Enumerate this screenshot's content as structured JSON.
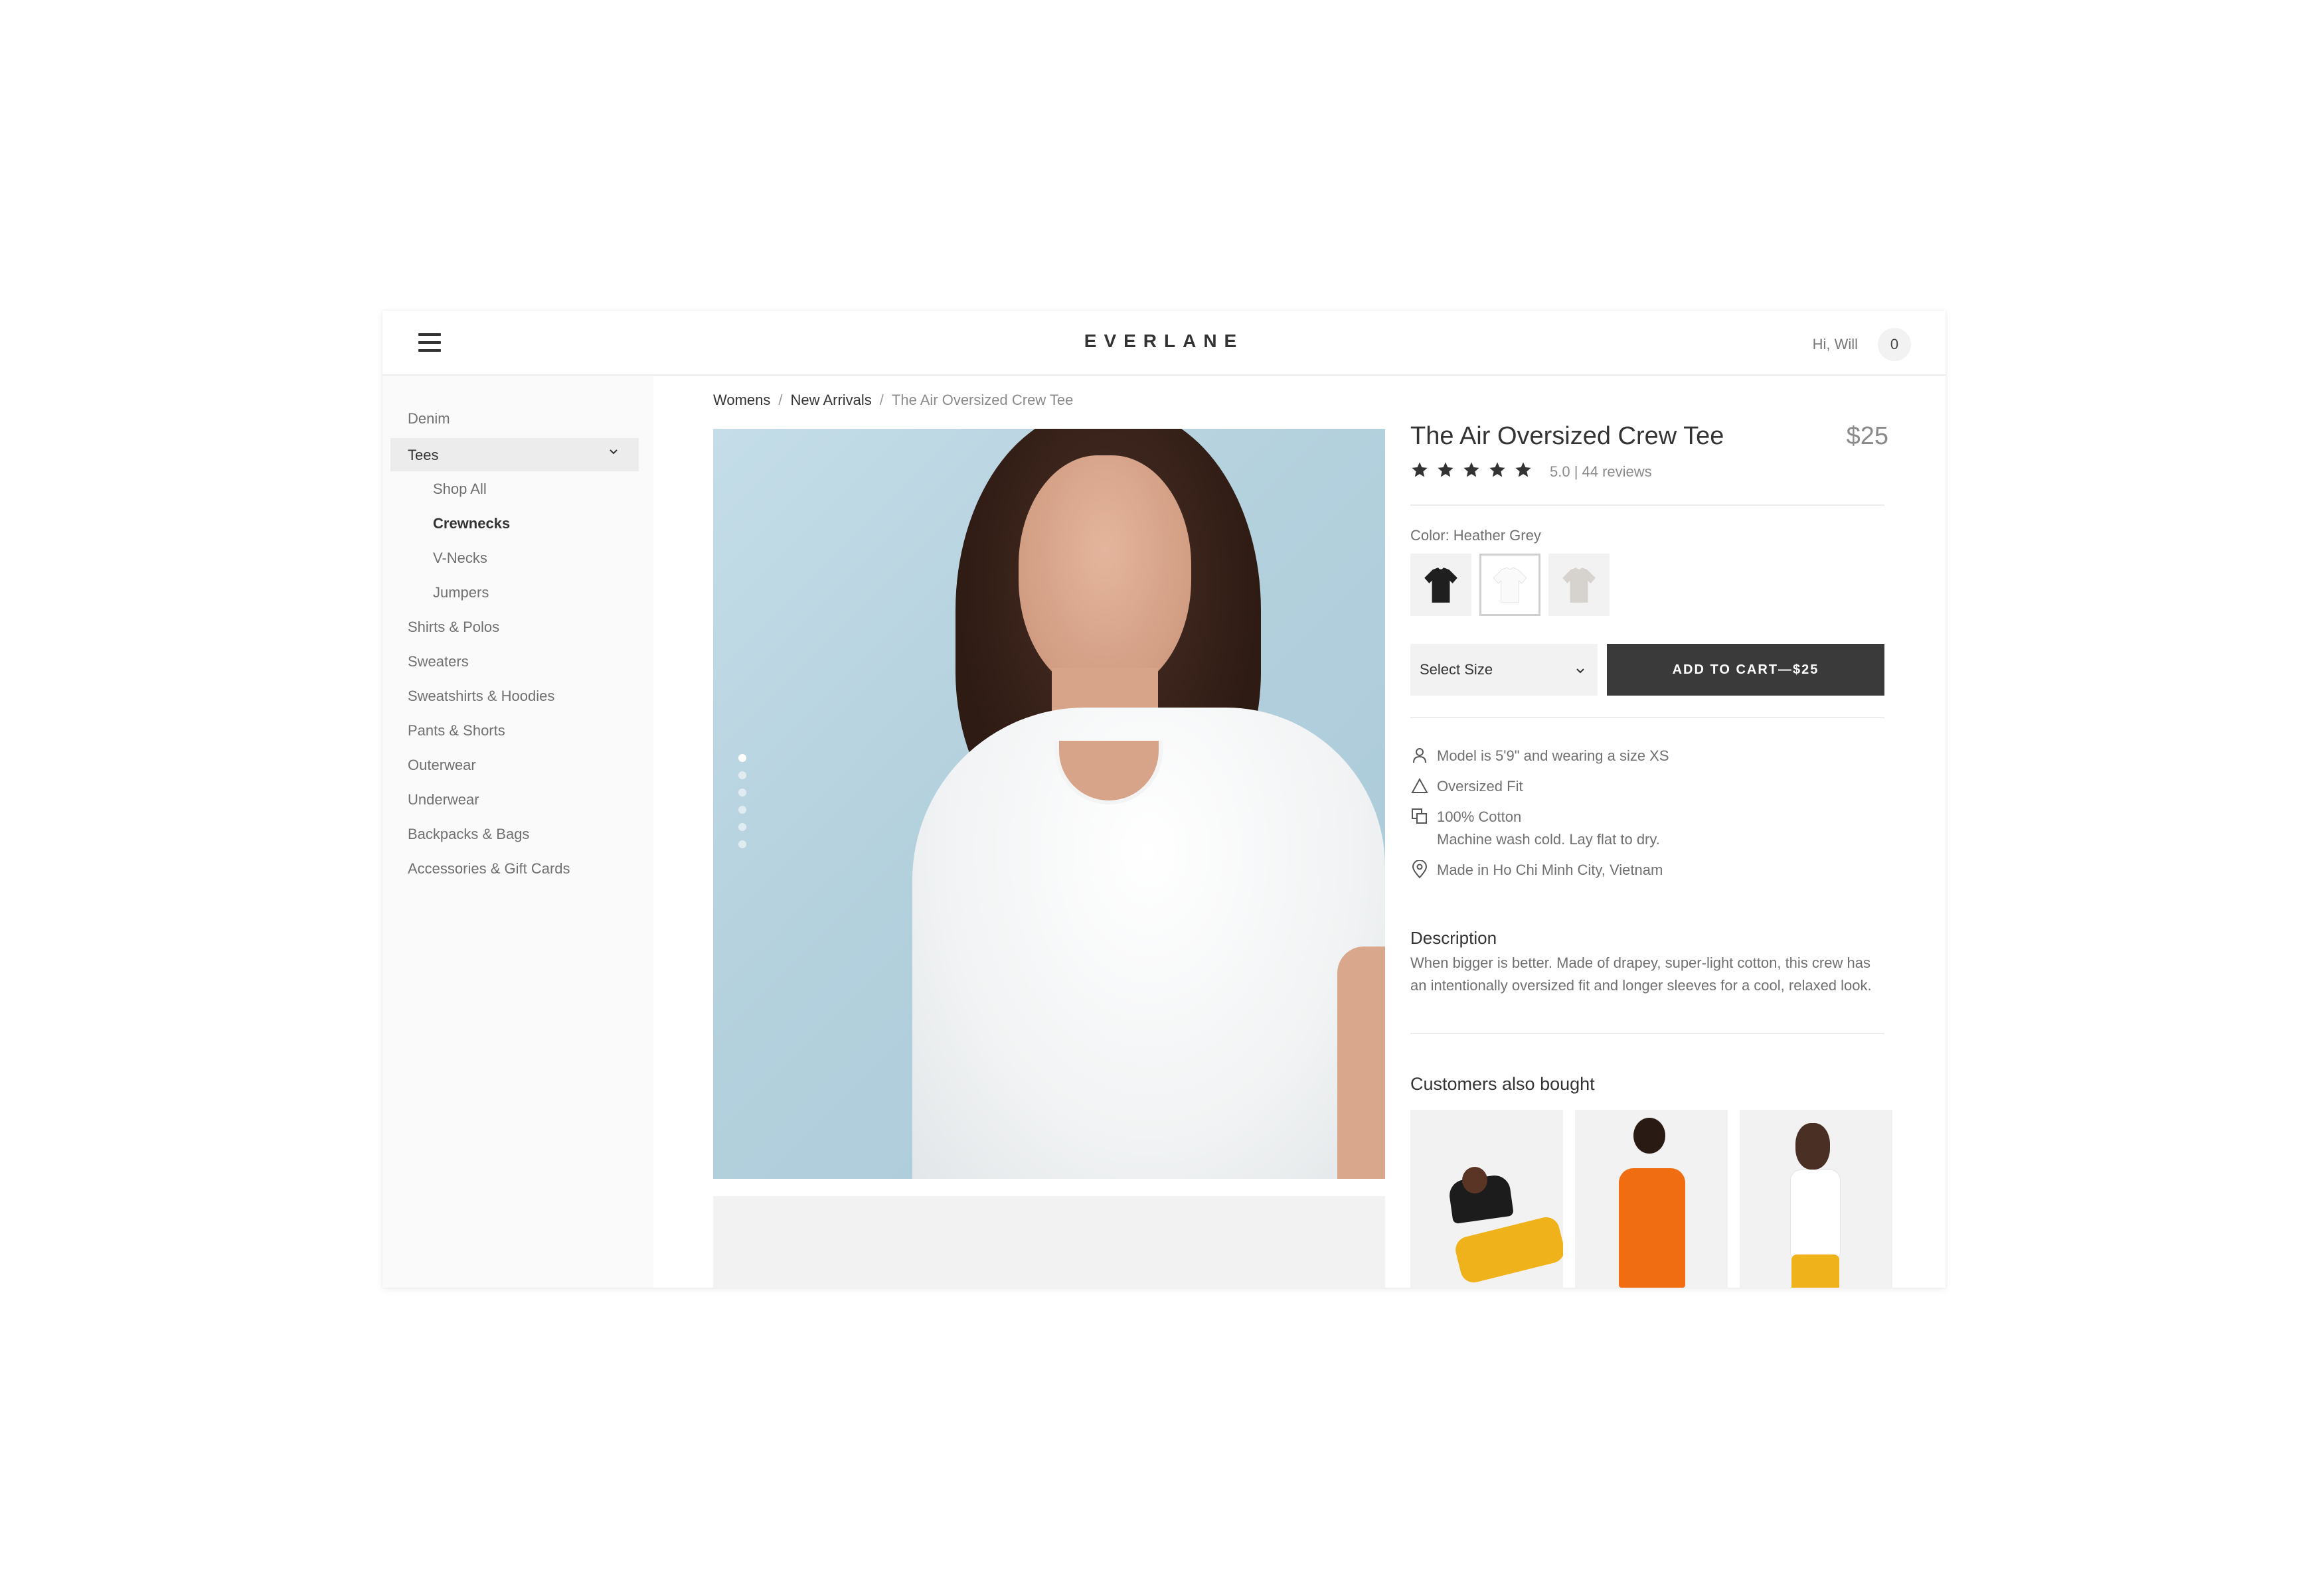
{
  "header": {
    "brand": "EVERLANE",
    "greeting": "Hi, Will",
    "cart_count": "0",
    "menu_icon": "hamburger-menu-icon"
  },
  "sidebar": {
    "items": [
      {
        "label": "Denim"
      },
      {
        "label": "Tees",
        "expanded": true
      },
      {
        "label": "Shop All"
      },
      {
        "label": "Crewnecks",
        "active": true
      },
      {
        "label": "V-Necks"
      },
      {
        "label": "Jumpers"
      },
      {
        "label": "Shirts & Polos"
      },
      {
        "label": "Sweaters"
      },
      {
        "label": "Sweatshirts & Hoodies"
      },
      {
        "label": "Pants & Shorts"
      },
      {
        "label": "Outerwear"
      },
      {
        "label": "Underwear"
      },
      {
        "label": "Backpacks & Bags"
      },
      {
        "label": "Accessories & Gift Cards"
      }
    ]
  },
  "breadcrumb": {
    "items": [
      "Womens",
      "New Arrivals"
    ],
    "separator": "/",
    "current": "The Air Oversized Crew Tee"
  },
  "gallery": {
    "image_count": 6,
    "active_index": 0
  },
  "product": {
    "title": "The Air Oversized Crew Tee",
    "price": "$25",
    "stars": 5,
    "rating_text": "5.0 | 44 reviews",
    "color_label": "Color: Heather Grey",
    "swatches": [
      {
        "name": "Black",
        "color": "#1f1f1f"
      },
      {
        "name": "White",
        "color": "#ffffff"
      },
      {
        "name": "Heather Grey",
        "color": "#d6d2cd"
      }
    ],
    "selected_swatch": 1,
    "size_placeholder": "Select Size",
    "add_to_cart": "ADD TO CART—$25"
  },
  "details": [
    {
      "icon": "person-icon",
      "text": "Model is 5'9\" and wearing a size XS"
    },
    {
      "icon": "triangle-fit-icon",
      "text": "Oversized Fit"
    },
    {
      "icon": "fabric-icon",
      "text": "100% Cotton",
      "subtext": "Machine wash cold. Lay flat to dry."
    },
    {
      "icon": "location-pin-icon",
      "text": "Made in Ho Chi Minh City, Vietnam"
    }
  ],
  "description": {
    "heading": "Description",
    "body": "When bigger is better. Made of drapey, super-light cotton, this crew has an intentionally oversized fit and longer sleeves for a cool, relaxed look."
  },
  "also_bought": {
    "heading": "Customers also bought",
    "items": [
      {
        "top_color": "#1c1c1c",
        "bottom_color": "#f0b21b"
      },
      {
        "top_color": "#f06d12",
        "bottom_color": "#f0b21b"
      },
      {
        "top_color": "#ffffff",
        "bottom_color": "#f0b21b"
      }
    ]
  },
  "colors": {
    "accent_dark": "#3a3a3a",
    "sidebar_bg": "#fafafa",
    "hero_bg": "#b9d6e3"
  }
}
